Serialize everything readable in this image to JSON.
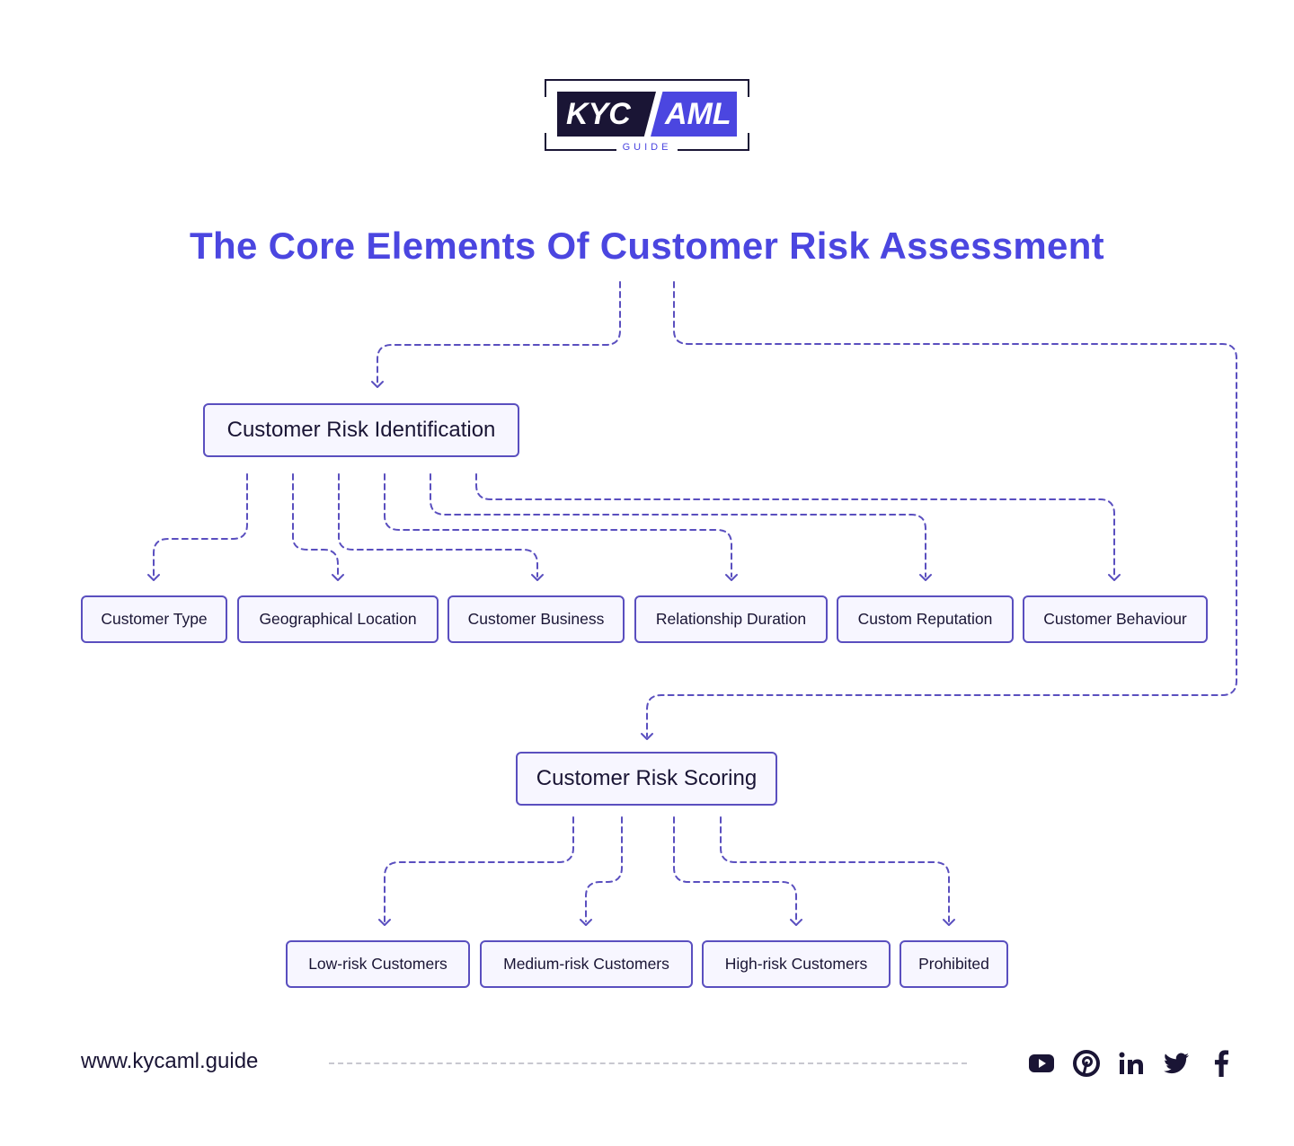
{
  "logo": {
    "left_text": "KYC",
    "right_text": "AML",
    "sub_text": "GUIDE"
  },
  "title": "The Core Elements Of Customer Risk Assessment",
  "colors": {
    "accent": "#4b46e0",
    "dark": "#1a1535",
    "node_border": "#5a4fbf",
    "node_fill": "#f7f6ff"
  },
  "diagram": {
    "level1": [
      {
        "id": "identification",
        "label": "Customer Risk Identification"
      },
      {
        "id": "scoring",
        "label": "Customer Risk Scoring"
      }
    ],
    "identification_children": [
      {
        "label": "Customer Type"
      },
      {
        "label": "Geographical Location"
      },
      {
        "label": "Customer Business"
      },
      {
        "label": "Relationship Duration"
      },
      {
        "label": "Custom Reputation"
      },
      {
        "label": "Customer Behaviour"
      }
    ],
    "scoring_children": [
      {
        "label": "Low-risk Customers"
      },
      {
        "label": "Medium-risk Customers"
      },
      {
        "label": "High-risk Customers"
      },
      {
        "label": "Prohibited"
      }
    ]
  },
  "footer": {
    "url": "www.kycaml.guide",
    "social_icons": [
      "youtube-icon",
      "pinterest-icon",
      "linkedin-icon",
      "twitter-icon",
      "facebook-icon"
    ]
  }
}
